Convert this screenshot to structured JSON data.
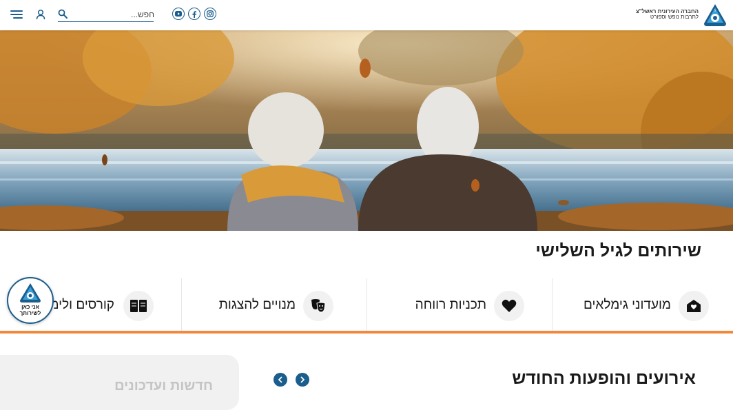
{
  "header": {
    "logo": {
      "line1": "החברה העירונית ראשל\"צ",
      "line2": "לתרבות נופש וספורט"
    },
    "social": [
      {
        "icon": "youtube-icon"
      },
      {
        "icon": "facebook-icon"
      },
      {
        "icon": "instagram-icon"
      }
    ],
    "search": {
      "placeholder": "חפש..."
    },
    "colors": {
      "accent": "#1b5d8c"
    }
  },
  "hero": {
    "image": "elderly-couple-by-lake-autumn"
  },
  "services": {
    "title": "שירותים לגיל השלישי",
    "items": [
      {
        "label": "מועדוני גימלאים",
        "icon": "home-heart-icon"
      },
      {
        "label": "תכניות רווחה",
        "icon": "heart-icon"
      },
      {
        "label": "מנויים להצגות",
        "icon": "theater-masks-icon"
      },
      {
        "label": "קורסים ולימוד",
        "icon": "book-icon"
      }
    ],
    "accent": "#f08a3a"
  },
  "accessibility": {
    "label_line1": "אני כאן",
    "label_line2": "לשירותך"
  },
  "events": {
    "title": "אירועים והופעות החודש",
    "panel_title": "חדשות ועדכונים"
  }
}
